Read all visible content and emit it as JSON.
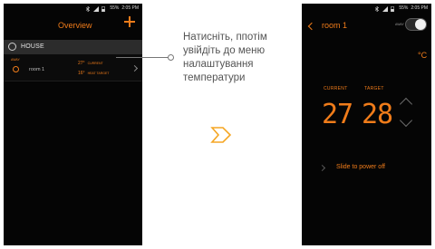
{
  "left_screen": {
    "status": {
      "battery": "55%",
      "time": "2:05 PM"
    },
    "title": "Overview",
    "house_label": "HOUSE",
    "room": {
      "mode_label": "AWAY",
      "name": "room 1",
      "current_temp": "27°",
      "current_label": "CURRENT",
      "target_temp": "16°",
      "target_label": "HEAT TARGET"
    }
  },
  "callout": {
    "text": "Натисніть, ппотім увійдіть до меню налаштування температури"
  },
  "right_screen": {
    "status": {
      "battery": "55%",
      "time": "2:05 PM"
    },
    "title": "room 1",
    "away_label": "AWAY",
    "unit": "°C",
    "current_label": "CURRENT",
    "target_label": "TARGET",
    "current_value": "27",
    "target_value": "28",
    "slide_text": "Slide to power off"
  },
  "colors": {
    "accent": "#f07c1a",
    "screen_bg": "#050505",
    "row_bg": "#2c2c2c"
  }
}
